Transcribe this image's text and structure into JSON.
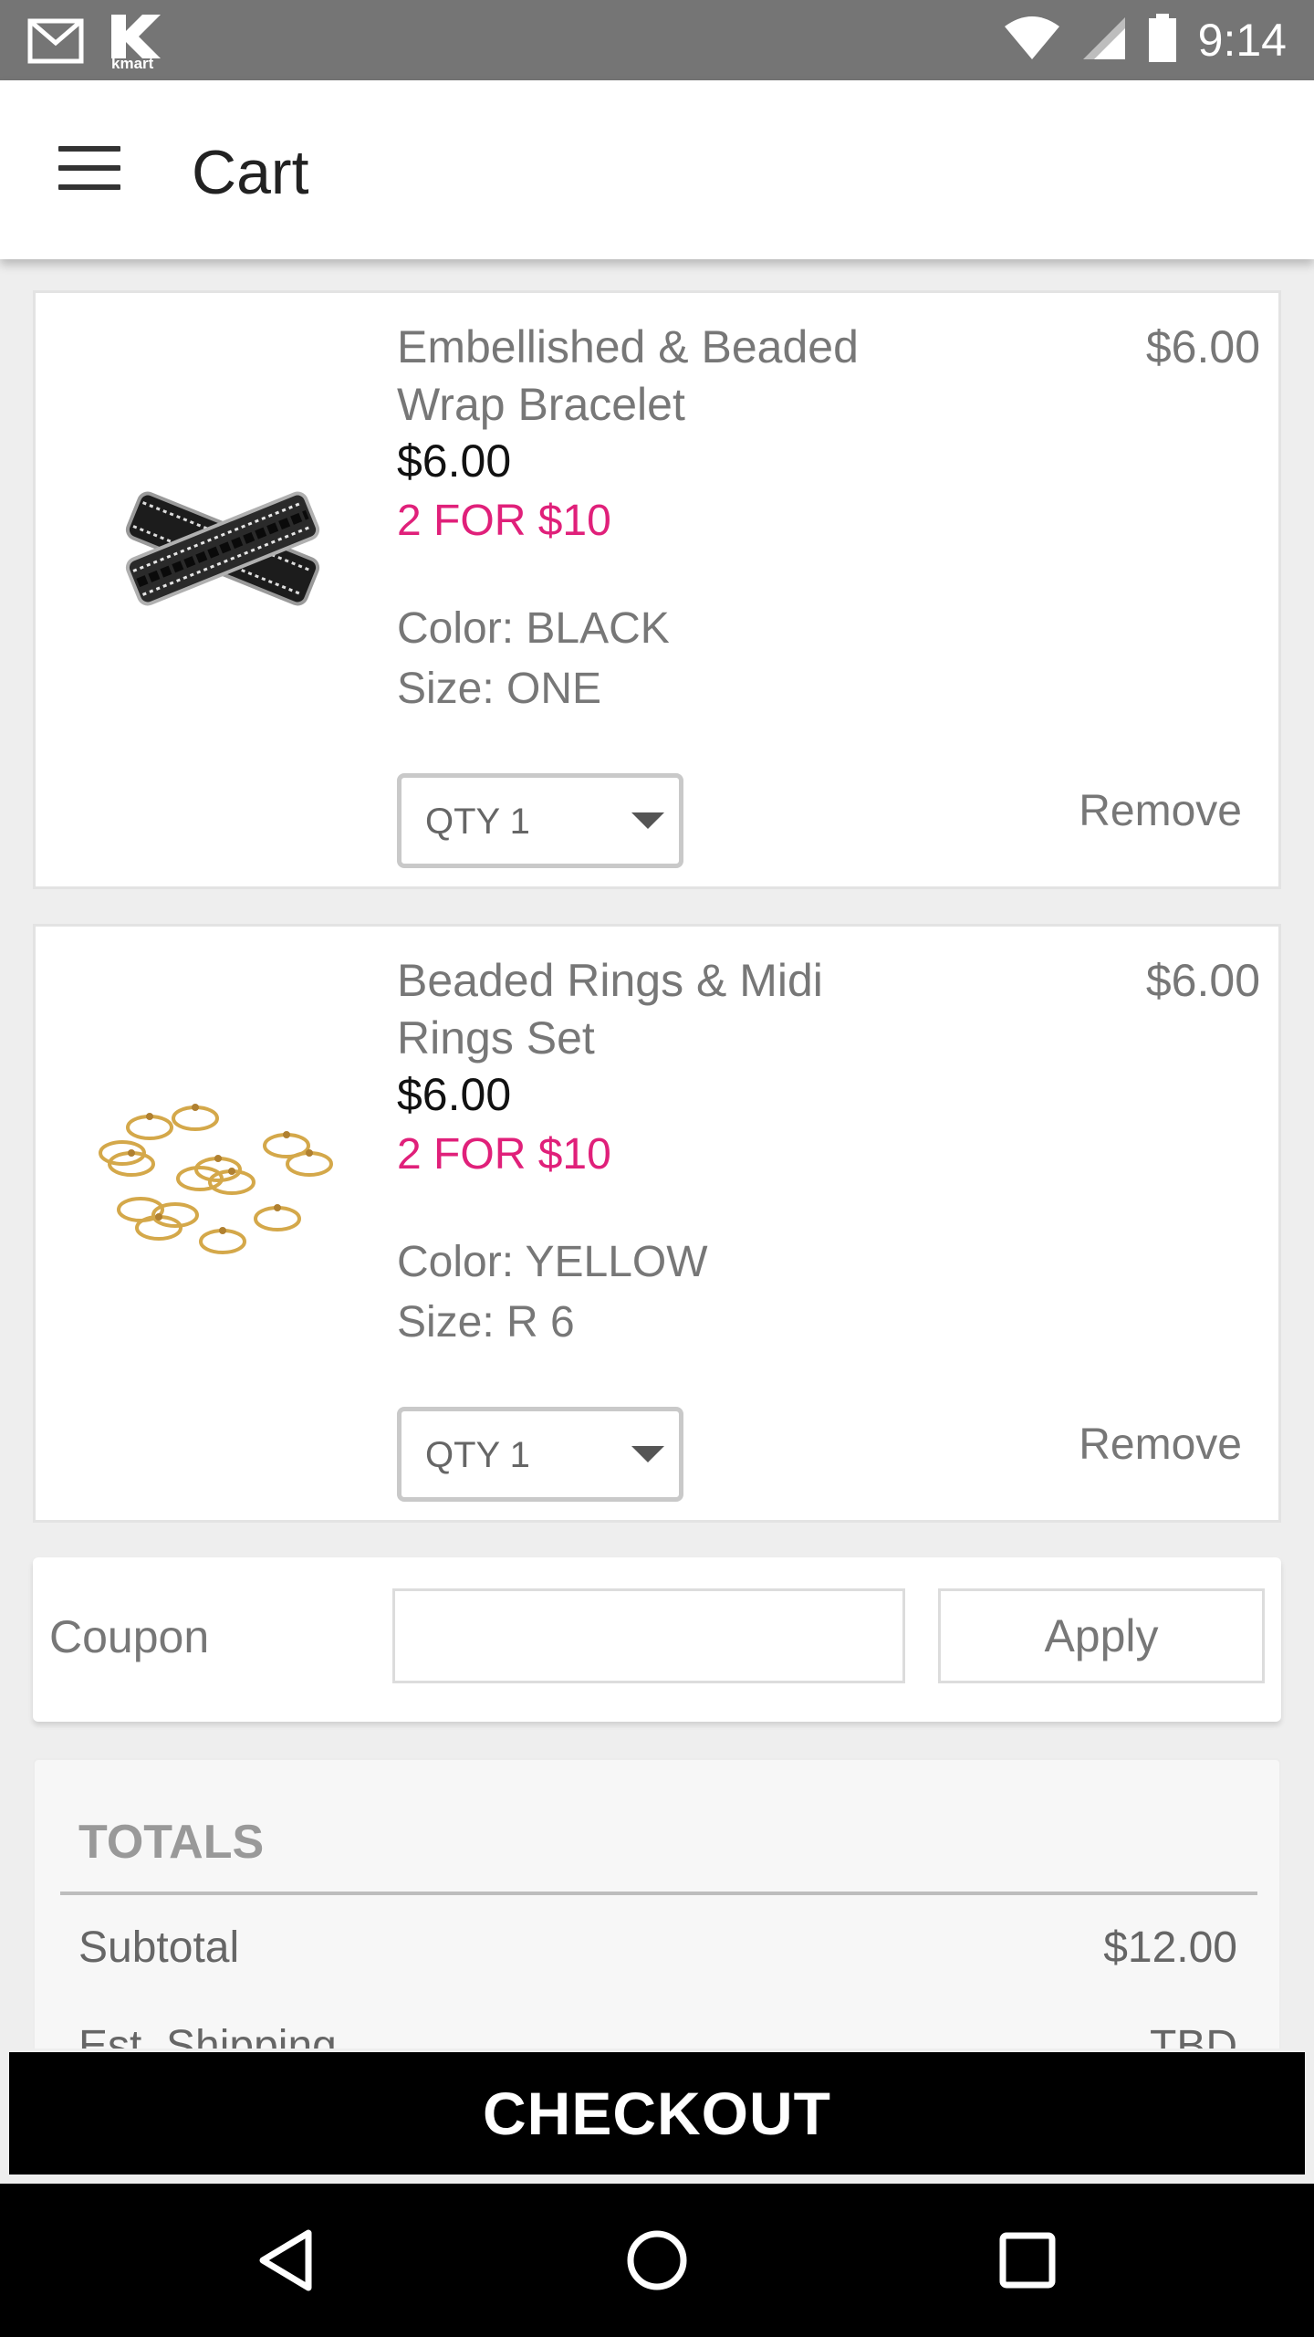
{
  "status_bar": {
    "time": "9:14",
    "icons": [
      "gmail-icon",
      "kmart-icon",
      "wifi-icon",
      "signal-icon",
      "battery-icon"
    ],
    "kmart_label": "kmart"
  },
  "app_bar": {
    "title": "Cart",
    "menu_icon": "hamburger-menu-icon"
  },
  "cart": {
    "items": [
      {
        "name": "Embellished & Beaded Wrap Bracelet",
        "total_price": "$6.00",
        "unit_price": "$6.00",
        "promo": "2 FOR $10",
        "color": "Color: BLACK",
        "size": "Size: ONE",
        "qty": "QTY 1",
        "remove_label": "Remove",
        "image": "bracelet-image"
      },
      {
        "name": "Beaded Rings & Midi Rings Set",
        "total_price": "$6.00",
        "unit_price": "$6.00",
        "promo": "2 FOR $10",
        "color": "Color: YELLOW",
        "size": "Size: R 6",
        "qty": "QTY 1",
        "remove_label": "Remove",
        "image": "rings-image"
      }
    ]
  },
  "coupon": {
    "label": "Coupon",
    "input_value": "",
    "apply_label": "Apply"
  },
  "totals": {
    "heading": "TOTALS",
    "rows": [
      {
        "label": "Subtotal",
        "value": "$12.00"
      },
      {
        "label": "Est. Shipping",
        "value": "TBD"
      }
    ]
  },
  "checkout": {
    "label": "CHECKOUT"
  },
  "nav_bar": {
    "buttons": [
      "back-icon",
      "home-icon",
      "recents-icon"
    ]
  },
  "colors": {
    "promo": "#e0207a",
    "checkout_bg": "#000000",
    "status_bar": "#757575"
  }
}
